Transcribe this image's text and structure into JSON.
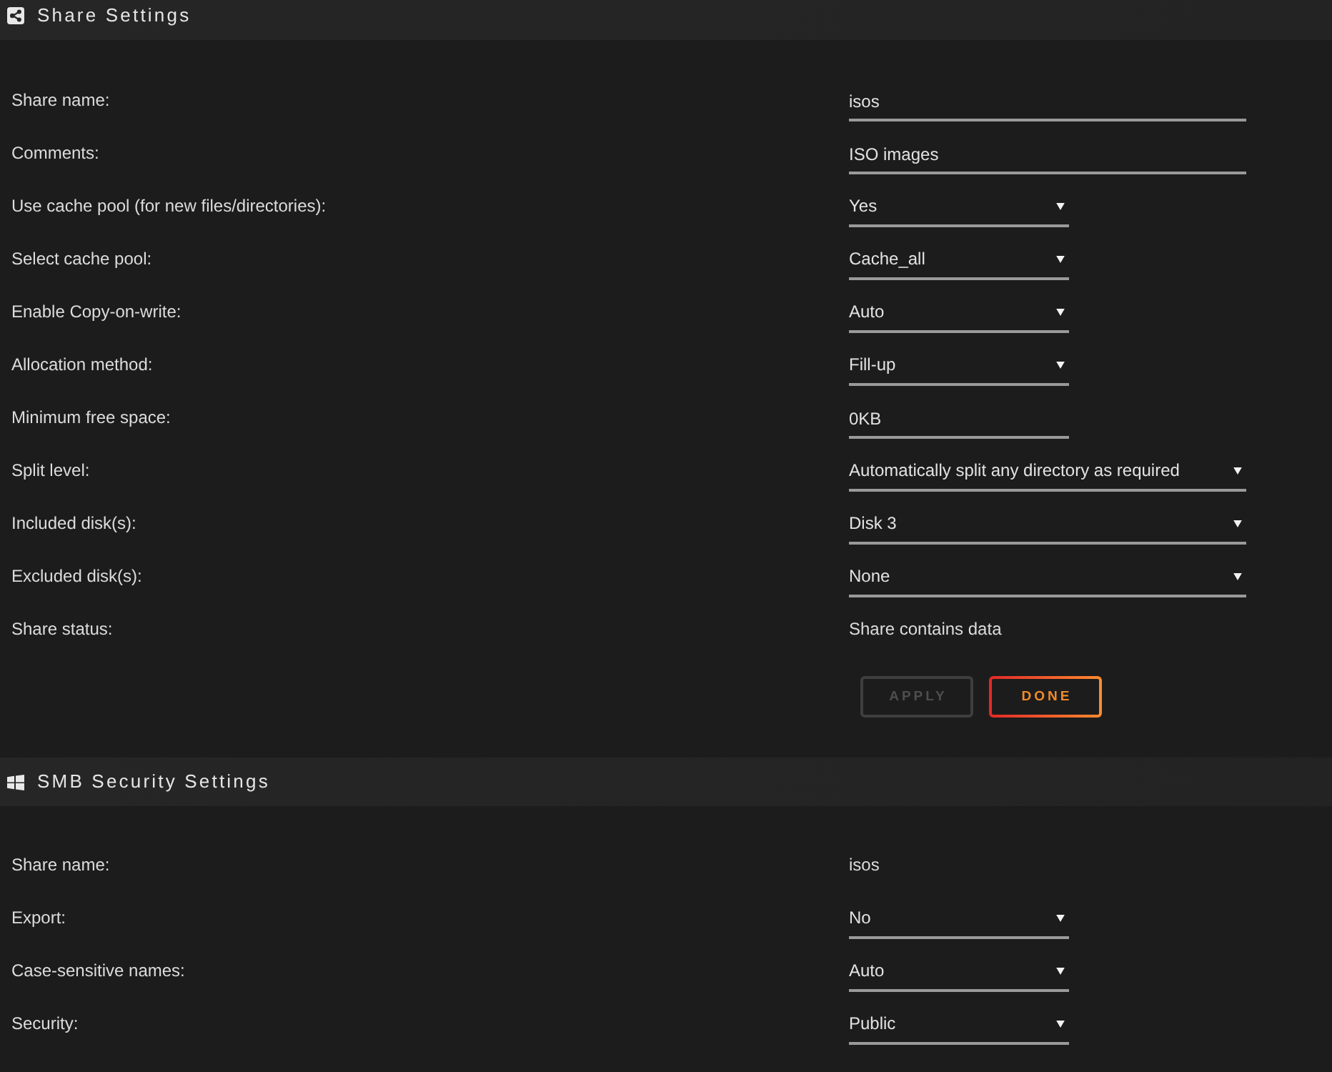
{
  "sections": [
    {
      "kind": "share",
      "title": "Share Settings",
      "rows": [
        {
          "label": "Share name:",
          "kind": "input",
          "value": "isos",
          "wide": true
        },
        {
          "label": "Comments:",
          "kind": "input",
          "value": "ISO images",
          "wide": true
        },
        {
          "label": "Use cache pool (for new files/directories):",
          "kind": "select",
          "value": "Yes",
          "wide": false
        },
        {
          "label": "Select cache pool:",
          "kind": "select",
          "value": "Cache_all",
          "wide": false
        },
        {
          "label": "Enable Copy-on-write:",
          "kind": "select",
          "value": "Auto",
          "wide": false
        },
        {
          "label": "Allocation method:",
          "kind": "select",
          "value": "Fill-up",
          "wide": false
        },
        {
          "label": "Minimum free space:",
          "kind": "input",
          "value": "0KB",
          "wide": false
        },
        {
          "label": "Split level:",
          "kind": "select",
          "value": "Automatically split any directory as required",
          "wide": true
        },
        {
          "label": "Included disk(s):",
          "kind": "select",
          "value": "Disk 3",
          "wide": true
        },
        {
          "label": "Excluded disk(s):",
          "kind": "select",
          "value": "None",
          "wide": true
        },
        {
          "label": "Share status:",
          "kind": "static",
          "value": "Share contains data"
        }
      ],
      "buttons": [
        {
          "label": "APPLY",
          "disabled": true
        },
        {
          "label": "DONE",
          "disabled": false
        }
      ]
    },
    {
      "kind": "smb",
      "title": "SMB Security Settings",
      "rows": [
        {
          "label": "Share name:",
          "kind": "static",
          "value": "isos"
        },
        {
          "label": "Export:",
          "kind": "select",
          "value": "No",
          "wide": false
        },
        {
          "label": "Case-sensitive names:",
          "kind": "select",
          "value": "Auto",
          "wide": false
        },
        {
          "label": "Security:",
          "kind": "select",
          "value": "Public",
          "wide": false
        }
      ]
    }
  ]
}
